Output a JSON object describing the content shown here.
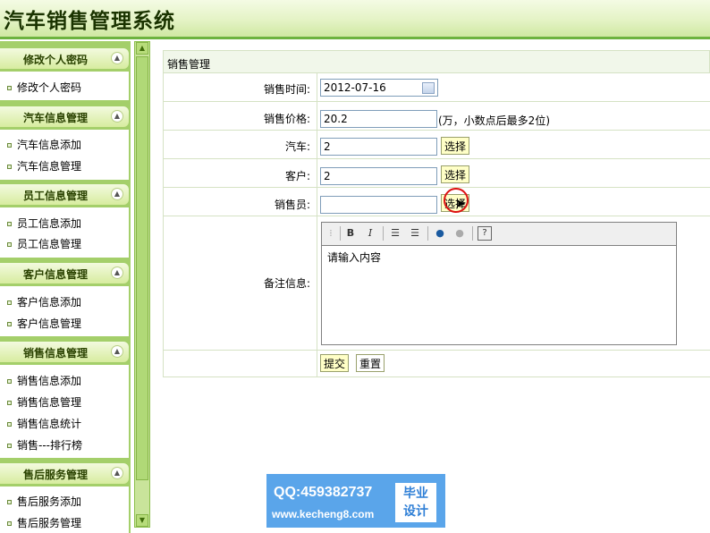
{
  "app": {
    "title": "汽车销售管理系统"
  },
  "sidebar": {
    "sections": [
      {
        "title": "修改个人密码",
        "items": [
          "修改个人密码"
        ]
      },
      {
        "title": "汽车信息管理",
        "items": [
          "汽车信息添加",
          "汽车信息管理"
        ]
      },
      {
        "title": "员工信息管理",
        "items": [
          "员工信息添加",
          "员工信息管理"
        ]
      },
      {
        "title": "客户信息管理",
        "items": [
          "客户信息添加",
          "客户信息管理"
        ]
      },
      {
        "title": "销售信息管理",
        "items": [
          "销售信息添加",
          "销售信息管理",
          "销售信息统计",
          "销售---排行榜"
        ]
      },
      {
        "title": "售后服务管理",
        "items": [
          "售后服务添加",
          "售后服务管理"
        ]
      }
    ],
    "toggle_glyph": "⌃"
  },
  "form": {
    "title": "销售管理",
    "fields": {
      "sale_time": {
        "label": "销售时间:",
        "value": "2012-07-16"
      },
      "sale_price": {
        "label": "销售价格:",
        "value": "20.2",
        "note": "(万，小数点后最多2位)"
      },
      "car": {
        "label": "汽车:",
        "value": "2",
        "button": "选择"
      },
      "customer": {
        "label": "客户:",
        "value": "2",
        "button": "选择"
      },
      "salesman": {
        "label": "销售员:",
        "value": "",
        "button": "选择"
      },
      "remark": {
        "label": "备注信息:",
        "placeholder": "请输入内容"
      }
    },
    "submit_label": "提交",
    "reset_label": "重置"
  },
  "watermark": {
    "qq": "QQ:459382737",
    "url": "www.kecheng8.com",
    "badge_line1": "毕业",
    "badge_line2": "设计"
  }
}
